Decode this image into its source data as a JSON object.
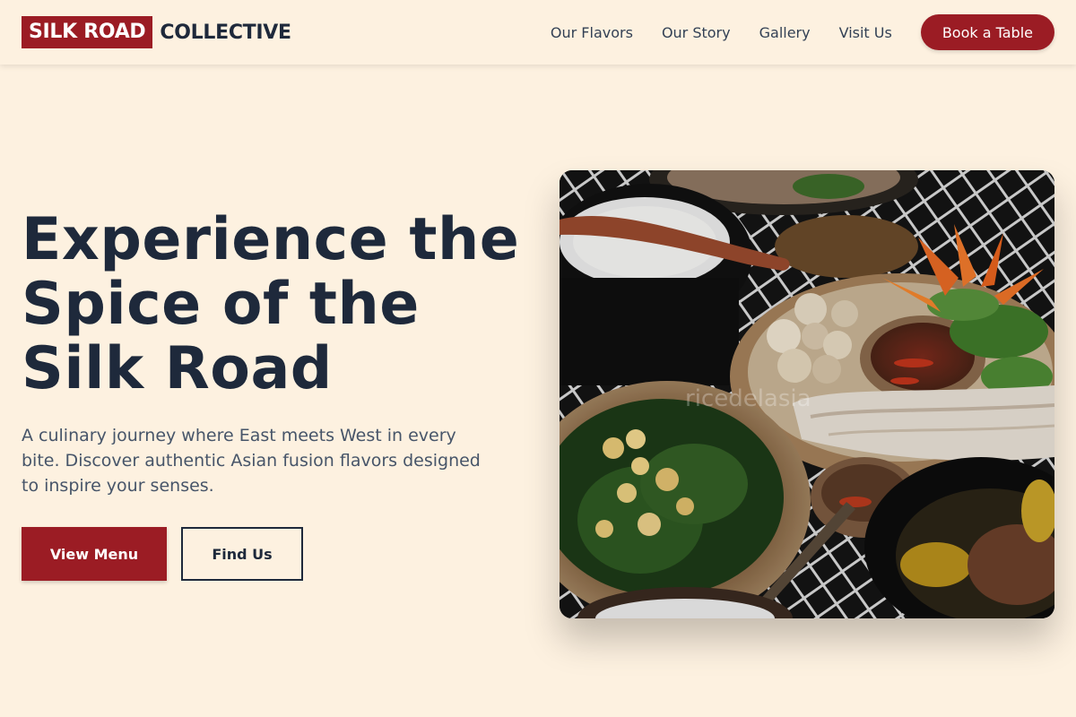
{
  "brand": {
    "name_highlight": "SILK ROAD",
    "name_rest": "COLLECTIVE",
    "accent_color": "#9b1c24"
  },
  "nav": {
    "links": [
      "Our Flavors",
      "Our Story",
      "Gallery",
      "Visit Us"
    ],
    "cta_label": "Book a Table"
  },
  "hero": {
    "title": "Experience the Spice of the Silk Road",
    "subtitle": "A culinary journey where East meets West in every bite. Discover authentic Asian fusion flavors designed to inspire your senses.",
    "primary_button": "View Menu",
    "secondary_button": "Find Us",
    "image_watermark": "ricedelasia"
  },
  "colors": {
    "background": "#fdf1e0",
    "text_dark": "#1e293b",
    "text_muted": "#475569"
  }
}
